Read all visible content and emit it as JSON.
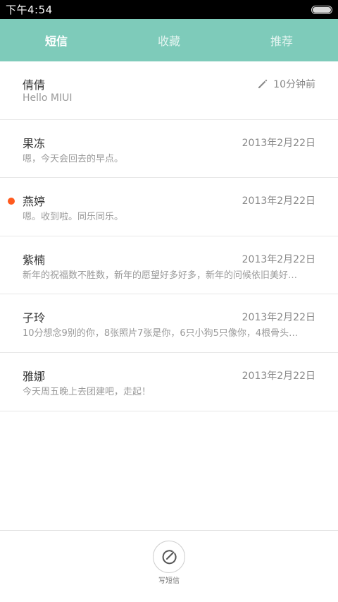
{
  "status_bar": {
    "time": "下午4:54"
  },
  "tabs": [
    {
      "label": "短信",
      "active": true
    },
    {
      "label": "收藏",
      "active": false
    },
    {
      "label": "推荐",
      "active": false
    }
  ],
  "messages": [
    {
      "name": "倩倩",
      "time": "10分钟前",
      "preview": "Hello MIUI",
      "draft": true,
      "unread": false
    },
    {
      "name": "果冻",
      "time": "2013年2月22日",
      "preview": "嗯，今天会回去的早点。",
      "draft": false,
      "unread": false
    },
    {
      "name": "燕婷",
      "time": "2013年2月22日",
      "preview": "嗯。收到啦。同乐同乐。",
      "draft": false,
      "unread": true
    },
    {
      "name": "紫楠",
      "time": "2013年2月22日",
      "preview": "新年的祝福数不胜数，新年的愿望好多好多，新年的问候依旧美好…",
      "draft": false,
      "unread": false
    },
    {
      "name": "子玲",
      "time": "2013年2月22日",
      "preview": "10分想念9别的你，8张照片7张是你，6只小狗5只像你，4根骨头…",
      "draft": false,
      "unread": false
    },
    {
      "name": "雅娜",
      "time": "2013年2月22日",
      "preview": "今天周五晚上去团建吧，走起！",
      "draft": false,
      "unread": false
    }
  ],
  "compose": {
    "label": "写短信"
  },
  "colors": {
    "header": "#7ecbba",
    "unread_dot": "#ff5a1e",
    "status_bar": "#000000"
  },
  "icons": {
    "draft": "pencil-icon",
    "compose": "compose-icon",
    "battery": "battery-icon"
  }
}
